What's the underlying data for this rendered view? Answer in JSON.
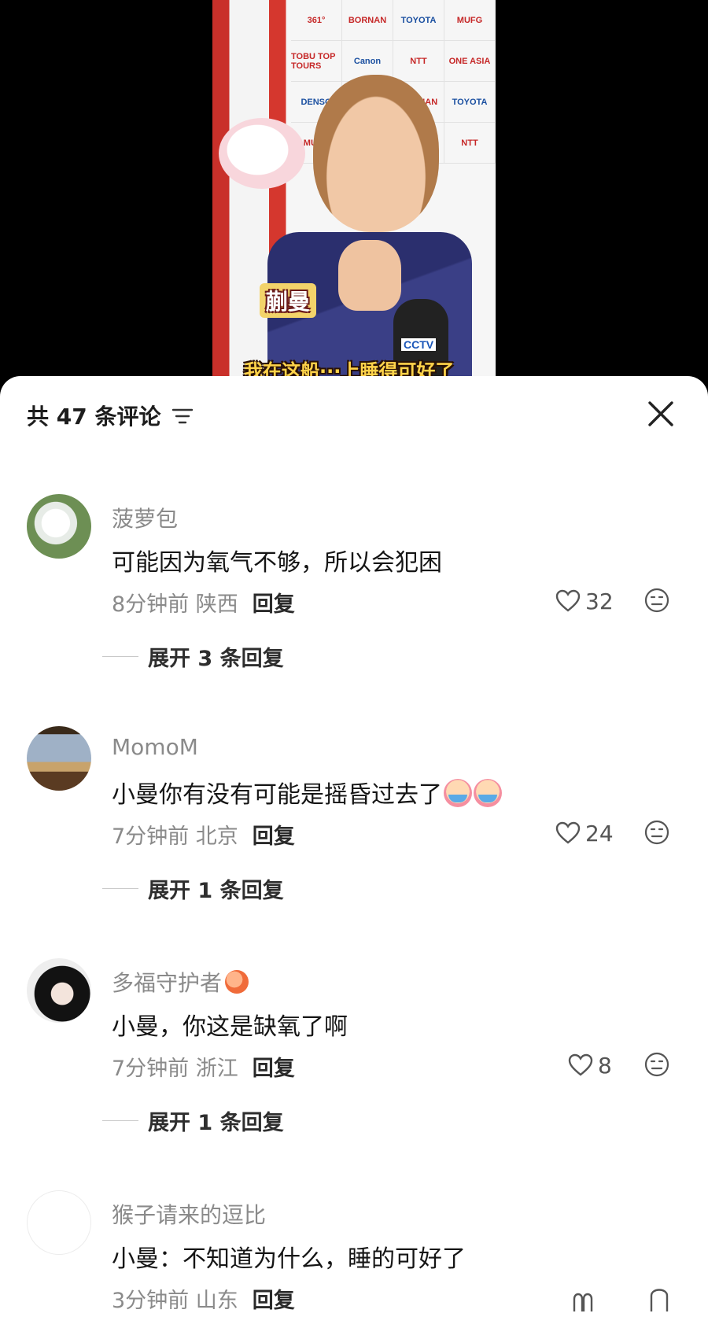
{
  "video": {
    "sponsors": [
      "361°",
      "BORNAN",
      "TOYOTA",
      "MUFG",
      "TOBU TOP TOURS",
      "Canon",
      "NTT",
      "ONE ASIA",
      "DENSO"
    ],
    "name_tag": "蒯曼",
    "subtitle": "我在这船···上睡得可好了",
    "mic_label": "CCTV"
  },
  "header": {
    "title": "共 47 条评论"
  },
  "comments": [
    {
      "username": "菠萝包",
      "content": "可能因为氧气不够，所以会犯困",
      "time_location": "8分钟前 陕西",
      "reply_label": "回复",
      "likes": "32",
      "expand_label": "展开 3 条回复"
    },
    {
      "username": "MomoM",
      "content": "小曼你有没有可能是摇昏过去了",
      "time_location": "7分钟前 北京",
      "reply_label": "回复",
      "likes": "24",
      "expand_label": "展开 1 条回复"
    },
    {
      "username": "多福守护者",
      "content": "小曼，你这是缺氧了啊",
      "time_location": "7分钟前 浙江",
      "reply_label": "回复",
      "likes": "8",
      "expand_label": "展开 1 条回复"
    },
    {
      "username": "猴子请来的逗比",
      "content": "小曼：不知道为什么，睡的可好了",
      "time_location": "3分钟前 山东",
      "reply_label": "回复"
    }
  ],
  "icons": {
    "sort": "sort-filter-icon",
    "close": "close-icon",
    "like": "heart-outline-icon",
    "dislike": "neutral-face-icon",
    "emoji_cry": "crying-face-emoji",
    "emoji_peach": "peach-emoji"
  },
  "colors": {
    "sheet_bg": "#ffffff",
    "text_primary": "#151515",
    "text_secondary": "#8a8a8a"
  }
}
